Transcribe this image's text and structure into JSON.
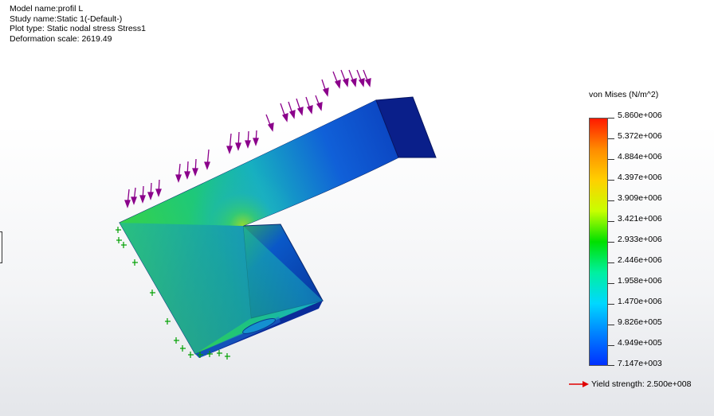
{
  "info": {
    "model_name": "Model name:profil L",
    "study_name": "Study name:Static 1(-Default-)",
    "plot_type": "Plot type: Static nodal stress Stress1",
    "deformation_scale": "Deformation scale: 2619.49"
  },
  "legend": {
    "title": "von Mises (N/m^2)",
    "labels": [
      "5.860e+006",
      "5.372e+006",
      "4.884e+006",
      "4.397e+006",
      "3.909e+006",
      "3.421e+006",
      "2.933e+006",
      "2.446e+006",
      "1.958e+006",
      "1.470e+006",
      "9.826e+005",
      "4.949e+005",
      "7.147e+003"
    ],
    "colors": [
      "#ff1a00",
      "#ff8c00",
      "#ffd000",
      "#c8ff00",
      "#00e000",
      "#00f0a0",
      "#00d8ff",
      "#0080ff",
      "#0030ff"
    ],
    "yield_label": "Yield strength: 2.500e+008",
    "yield_arrow_color": "#e00000"
  },
  "model": {
    "load_arrow_color": "#8b008b",
    "fixture_color": "#00a000"
  }
}
